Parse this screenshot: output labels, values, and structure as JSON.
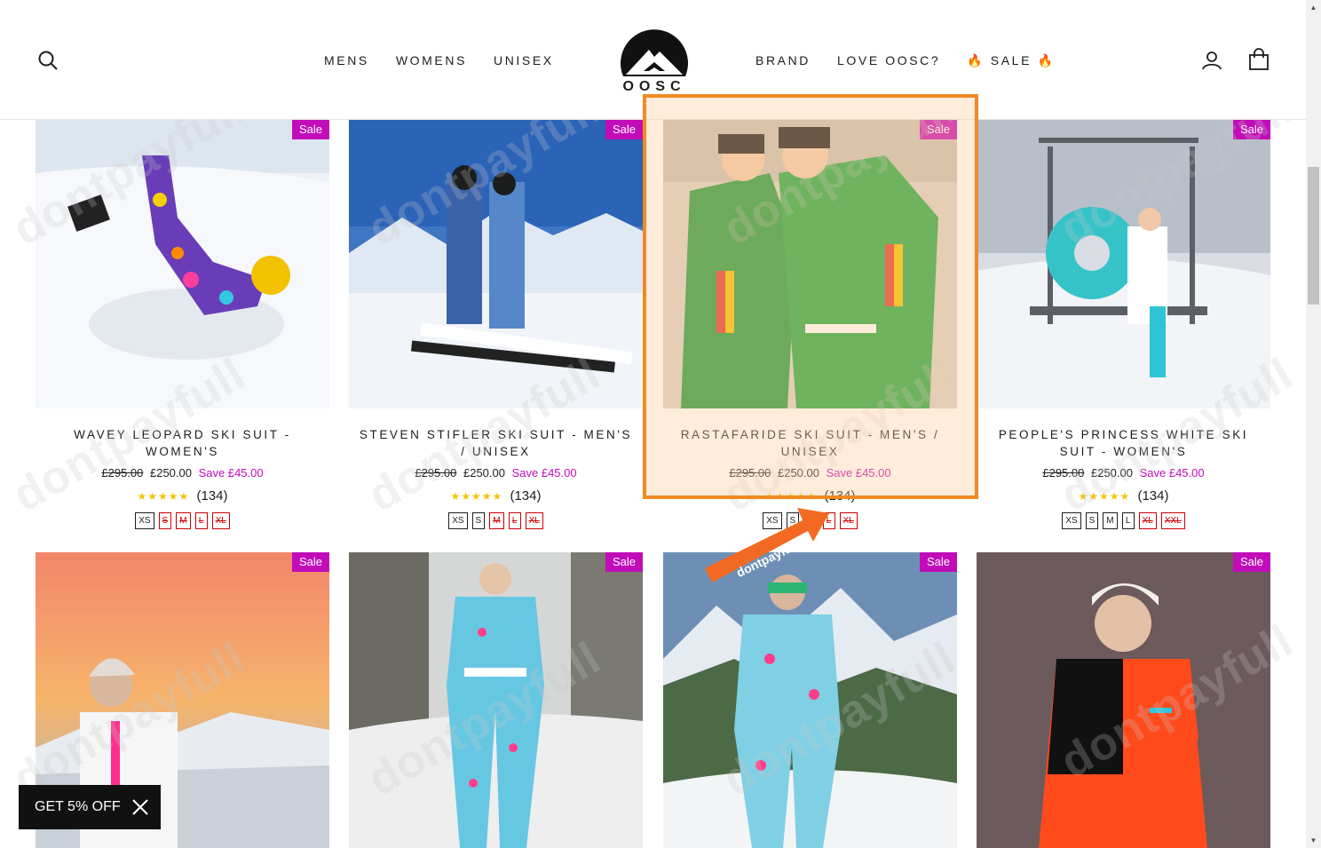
{
  "nav": {
    "left": [
      "MENS",
      "WOMENS",
      "UNISEX"
    ],
    "right": [
      "BRAND",
      "LOVE OOSC?",
      "🔥 SALE 🔥"
    ],
    "logo_text": "OOSC"
  },
  "icons": {
    "search": "search-icon",
    "account": "user-icon",
    "cart": "cart-icon"
  },
  "products": [
    {
      "badge": "Sale",
      "title": "WAVEY LEOPARD SKI SUIT - WOMEN'S",
      "was": "£295.00",
      "now": "£250.00",
      "save": "Save £45.00",
      "stars": "★★★★★",
      "reviews": "(134)",
      "sizes": [
        {
          "l": "XS",
          "out": false
        },
        {
          "l": "S",
          "out": true
        },
        {
          "l": "M",
          "out": true
        },
        {
          "l": "L",
          "out": true
        },
        {
          "l": "XL",
          "out": true
        }
      ]
    },
    {
      "badge": "Sale",
      "title": "STEVEN STIFLER SKI SUIT - MEN'S / UNISEX",
      "was": "£295.00",
      "now": "£250.00",
      "save": "Save £45.00",
      "stars": "★★★★★",
      "reviews": "(134)",
      "sizes": [
        {
          "l": "XS",
          "out": false
        },
        {
          "l": "S",
          "out": false
        },
        {
          "l": "M",
          "out": true
        },
        {
          "l": "L",
          "out": true
        },
        {
          "l": "XL",
          "out": true
        }
      ]
    },
    {
      "badge": "Sale",
      "title": "RASTAFARIDE SKI SUIT - MEN'S / UNISEX",
      "was": "£295.00",
      "now": "£250.00",
      "save": "Save £45.00",
      "stars": "★★★★★",
      "reviews": "(134)",
      "sizes": [
        {
          "l": "XS",
          "out": false
        },
        {
          "l": "S",
          "out": false
        },
        {
          "l": "M",
          "out": false
        },
        {
          "l": "L",
          "out": true
        },
        {
          "l": "XL",
          "out": true
        }
      ]
    },
    {
      "badge": "Sale",
      "title": "PEOPLE'S PRINCESS WHITE SKI SUIT - WOMEN'S",
      "was": "£295.00",
      "now": "£250.00",
      "save": "Save £45.00",
      "stars": "★★★★★",
      "reviews": "(134)",
      "sizes": [
        {
          "l": "XS",
          "out": false
        },
        {
          "l": "S",
          "out": false
        },
        {
          "l": "M",
          "out": false
        },
        {
          "l": "L",
          "out": false
        },
        {
          "l": "XL",
          "out": true
        },
        {
          "l": "XXL",
          "out": true
        }
      ]
    },
    {
      "badge": "Sale"
    },
    {
      "badge": "Sale"
    },
    {
      "badge": "Sale"
    },
    {
      "badge": "Sale"
    }
  ],
  "promo": {
    "label": "GET 5% OFF"
  },
  "watermark": "dontpayfull",
  "colors": {
    "sale_badge": "#c20cb9",
    "highlight": "#f08a24",
    "text": "#1c1d1d"
  }
}
